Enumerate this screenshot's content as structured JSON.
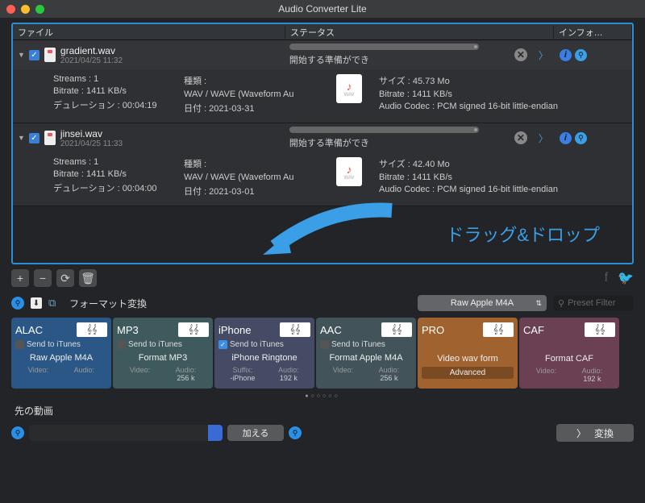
{
  "window": {
    "title": "Audio Converter Lite"
  },
  "headers": {
    "file": "ファイル",
    "status": "ステータス",
    "info": "インフォ…"
  },
  "files": [
    {
      "name": "gradient.wav",
      "date": "2021/04/25 11:32",
      "progress_text": "開始する準備ができ",
      "streams": "Streams : 1",
      "bitrate": "Bitrate : 1411 KB/s",
      "duration": "デュレーション : 00:04:19",
      "type_label": "種類 :",
      "type_value": "WAV / WAVE (Waveform Au",
      "date2": "日付 : 2021-03-31",
      "size": "サイズ : 45.73 Mo",
      "bitrate2": "Bitrate : 1411 KB/s",
      "codec": "Audio Codec : PCM signed 16-bit little-endian"
    },
    {
      "name": "jinsei.wav",
      "date": "2021/04/25 11:33",
      "progress_text": "開始する準備ができ",
      "streams": "Streams : 1",
      "bitrate": "Bitrate : 1411 KB/s",
      "duration": "デュレーション : 00:04:00",
      "type_label": "種類 :",
      "type_value": "WAV / WAVE (Waveform Au",
      "date2": "日付 : 2021-03-01",
      "size": "サイズ : 42.40 Mo",
      "bitrate2": "Bitrate : 1411 KB/s",
      "codec": "Audio Codec : PCM signed 16-bit little-endian"
    }
  ],
  "drag_text": "ドラッグ&ドロップ",
  "format_section": {
    "label": "フォーマット変換",
    "selected": "Raw Apple M4A",
    "preset_placeholder": "Preset Filter"
  },
  "cards": {
    "alac": {
      "code": "ALAC",
      "itunes": "Send to iTunes",
      "name": "Raw Apple M4A",
      "v": "Video:",
      "a": "Audio:"
    },
    "mp3": {
      "code": "MP3",
      "itunes": "Send to iTunes",
      "name": "Format MP3",
      "v": "Video:",
      "a": "Audio:",
      "av": "256   k"
    },
    "iphone": {
      "code": "iPhone",
      "itunes": "Send to iTunes",
      "name": "iPhone Ringtone",
      "sl": "Suffix:",
      "sv": "-iPhone",
      "a": "Audio:",
      "av": "192   k"
    },
    "aac": {
      "code": "AAC",
      "itunes": "Send to iTunes",
      "name": "Format Apple M4A",
      "v": "Video:",
      "a": "Audio:",
      "av": "256   k"
    },
    "pro": {
      "code": "PRO",
      "name": "Video wav form",
      "adv": "Advanced"
    },
    "caf": {
      "code": "CAF",
      "name": "Format CAF",
      "v": "Video:",
      "a": "Audio:",
      "av": "192   k"
    }
  },
  "dest": {
    "label": "先の動画",
    "add": "加える",
    "convert": "変換"
  }
}
